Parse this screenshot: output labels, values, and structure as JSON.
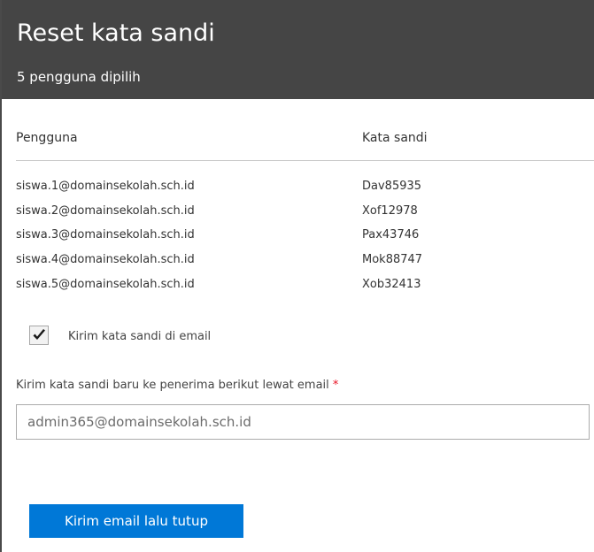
{
  "header": {
    "title": "Reset kata sandi",
    "subtitle": "5 pengguna dipilih"
  },
  "table": {
    "columns": [
      "Pengguna",
      "Kata sandi"
    ],
    "rows": [
      {
        "user": "siswa.1@domainsekolah.sch.id",
        "password": "Dav85935"
      },
      {
        "user": "siswa.2@domainsekolah.sch.id",
        "password": "Xof12978"
      },
      {
        "user": "siswa.3@domainsekolah.sch.id",
        "password": "Pax43746"
      },
      {
        "user": "siswa.4@domainsekolah.sch.id",
        "password": "Mok88747"
      },
      {
        "user": "siswa.5@domainsekolah.sch.id",
        "password": "Xob32413"
      }
    ]
  },
  "email_option": {
    "checkbox_label": "Kirim kata sandi di email",
    "checked": true,
    "checkbox_icon": "checkmark-icon"
  },
  "recipient": {
    "label": "Kirim kata sandi baru ke penerima berikut lewat email",
    "required_marker": "*",
    "value": "admin365@domainsekolah.sch.id"
  },
  "actions": {
    "submit_label": "Kirim email lalu tutup"
  },
  "colors": {
    "header_bg": "#454545",
    "accent": "#0078d7",
    "required": "#e81123"
  }
}
